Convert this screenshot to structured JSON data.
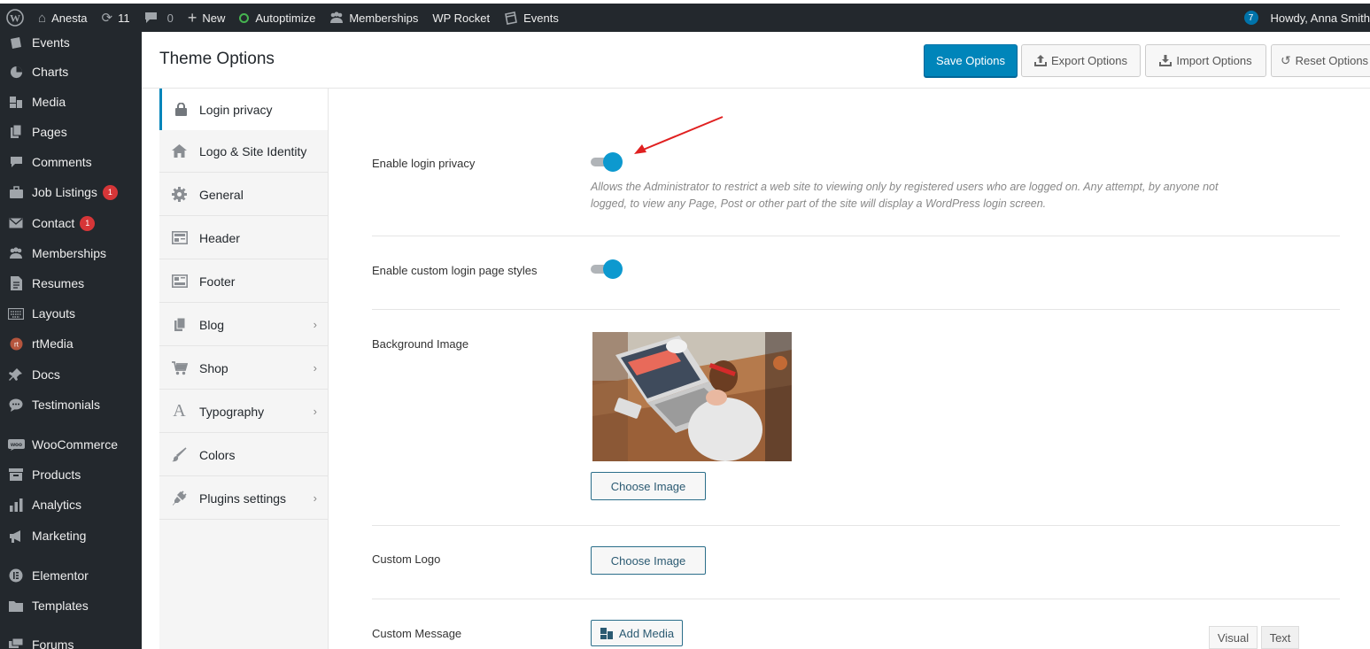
{
  "admin_bar": {
    "site_name": "Anesta",
    "updates_count": "11",
    "comments_count": "0",
    "new_label": "New",
    "autoptimize_label": "Autoptimize",
    "memberships_label": "Memberships",
    "wprocket_label": "WP Rocket",
    "events_label": "Events",
    "notif_count": "7",
    "howdy_label": "Howdy, Anna Smith"
  },
  "sidebar": {
    "items": [
      {
        "label": "Events",
        "icon": "events-icon"
      },
      {
        "label": "Charts",
        "icon": "pie-chart-icon"
      },
      {
        "label": "Media",
        "icon": "media-icon"
      },
      {
        "label": "Pages",
        "icon": "pages-icon"
      },
      {
        "label": "Comments",
        "icon": "comment-icon"
      },
      {
        "label": "Job Listings",
        "icon": "briefcase-icon",
        "badge": "1"
      },
      {
        "label": "Contact",
        "icon": "mail-icon",
        "badge": "1"
      },
      {
        "label": "Memberships",
        "icon": "group-icon"
      },
      {
        "label": "Resumes",
        "icon": "document-icon"
      },
      {
        "label": "Layouts",
        "icon": "keyboard-icon"
      },
      {
        "label": "rtMedia",
        "icon": "rtmedia-icon"
      },
      {
        "label": "Docs",
        "icon": "pin-icon"
      },
      {
        "label": "Testimonials",
        "icon": "speech-icon"
      },
      {
        "label": "WooCommerce",
        "icon": "woo-icon"
      },
      {
        "label": "Products",
        "icon": "archive-icon"
      },
      {
        "label": "Analytics",
        "icon": "bar-chart-icon"
      },
      {
        "label": "Marketing",
        "icon": "megaphone-icon"
      },
      {
        "label": "Elementor",
        "icon": "elementor-icon"
      },
      {
        "label": "Templates",
        "icon": "folder-icon"
      },
      {
        "label": "Forums",
        "icon": "forums-icon"
      }
    ]
  },
  "header": {
    "title": "Theme Options",
    "save_label": "Save Options",
    "export_label": "Export Options",
    "import_label": "Import Options",
    "reset_label": "Reset Options"
  },
  "tabs": [
    {
      "label": "Login privacy",
      "icon": "lock-icon",
      "active": true
    },
    {
      "label": "Logo & Site Identity",
      "icon": "home-icon"
    },
    {
      "label": "General",
      "icon": "gear-icon"
    },
    {
      "label": "Header",
      "icon": "header-icon"
    },
    {
      "label": "Footer",
      "icon": "footer-icon"
    },
    {
      "label": "Blog",
      "icon": "blog-icon",
      "has_children": true
    },
    {
      "label": "Shop",
      "icon": "cart-icon",
      "has_children": true
    },
    {
      "label": "Typography",
      "icon": "typography-icon",
      "has_children": true
    },
    {
      "label": "Colors",
      "icon": "brush-icon"
    },
    {
      "label": "Plugins settings",
      "icon": "plugin-icon",
      "has_children": true
    }
  ],
  "fields": {
    "login_privacy_label": "Enable login privacy",
    "login_privacy_desc": "Allows the Administrator to restrict a web site to viewing only by registered users who are logged on. Any attempt, by anyone not logged, to view any Page, Post or other part of the site will display a WordPress login screen.",
    "custom_styles_label": "Enable custom login page styles",
    "bg_image_label": "Background Image",
    "choose_image_label": "Choose Image",
    "custom_logo_label": "Custom Logo",
    "custom_message_label": "Custom Message",
    "add_media_label": "Add Media",
    "visual_tab": "Visual",
    "text_tab": "Text"
  },
  "colors": {
    "accent": "#0085ba",
    "toggle_on": "#0d99cf",
    "admin_dark": "#23282d",
    "badge_red": "#d63638",
    "arrow_red": "#e02020"
  }
}
